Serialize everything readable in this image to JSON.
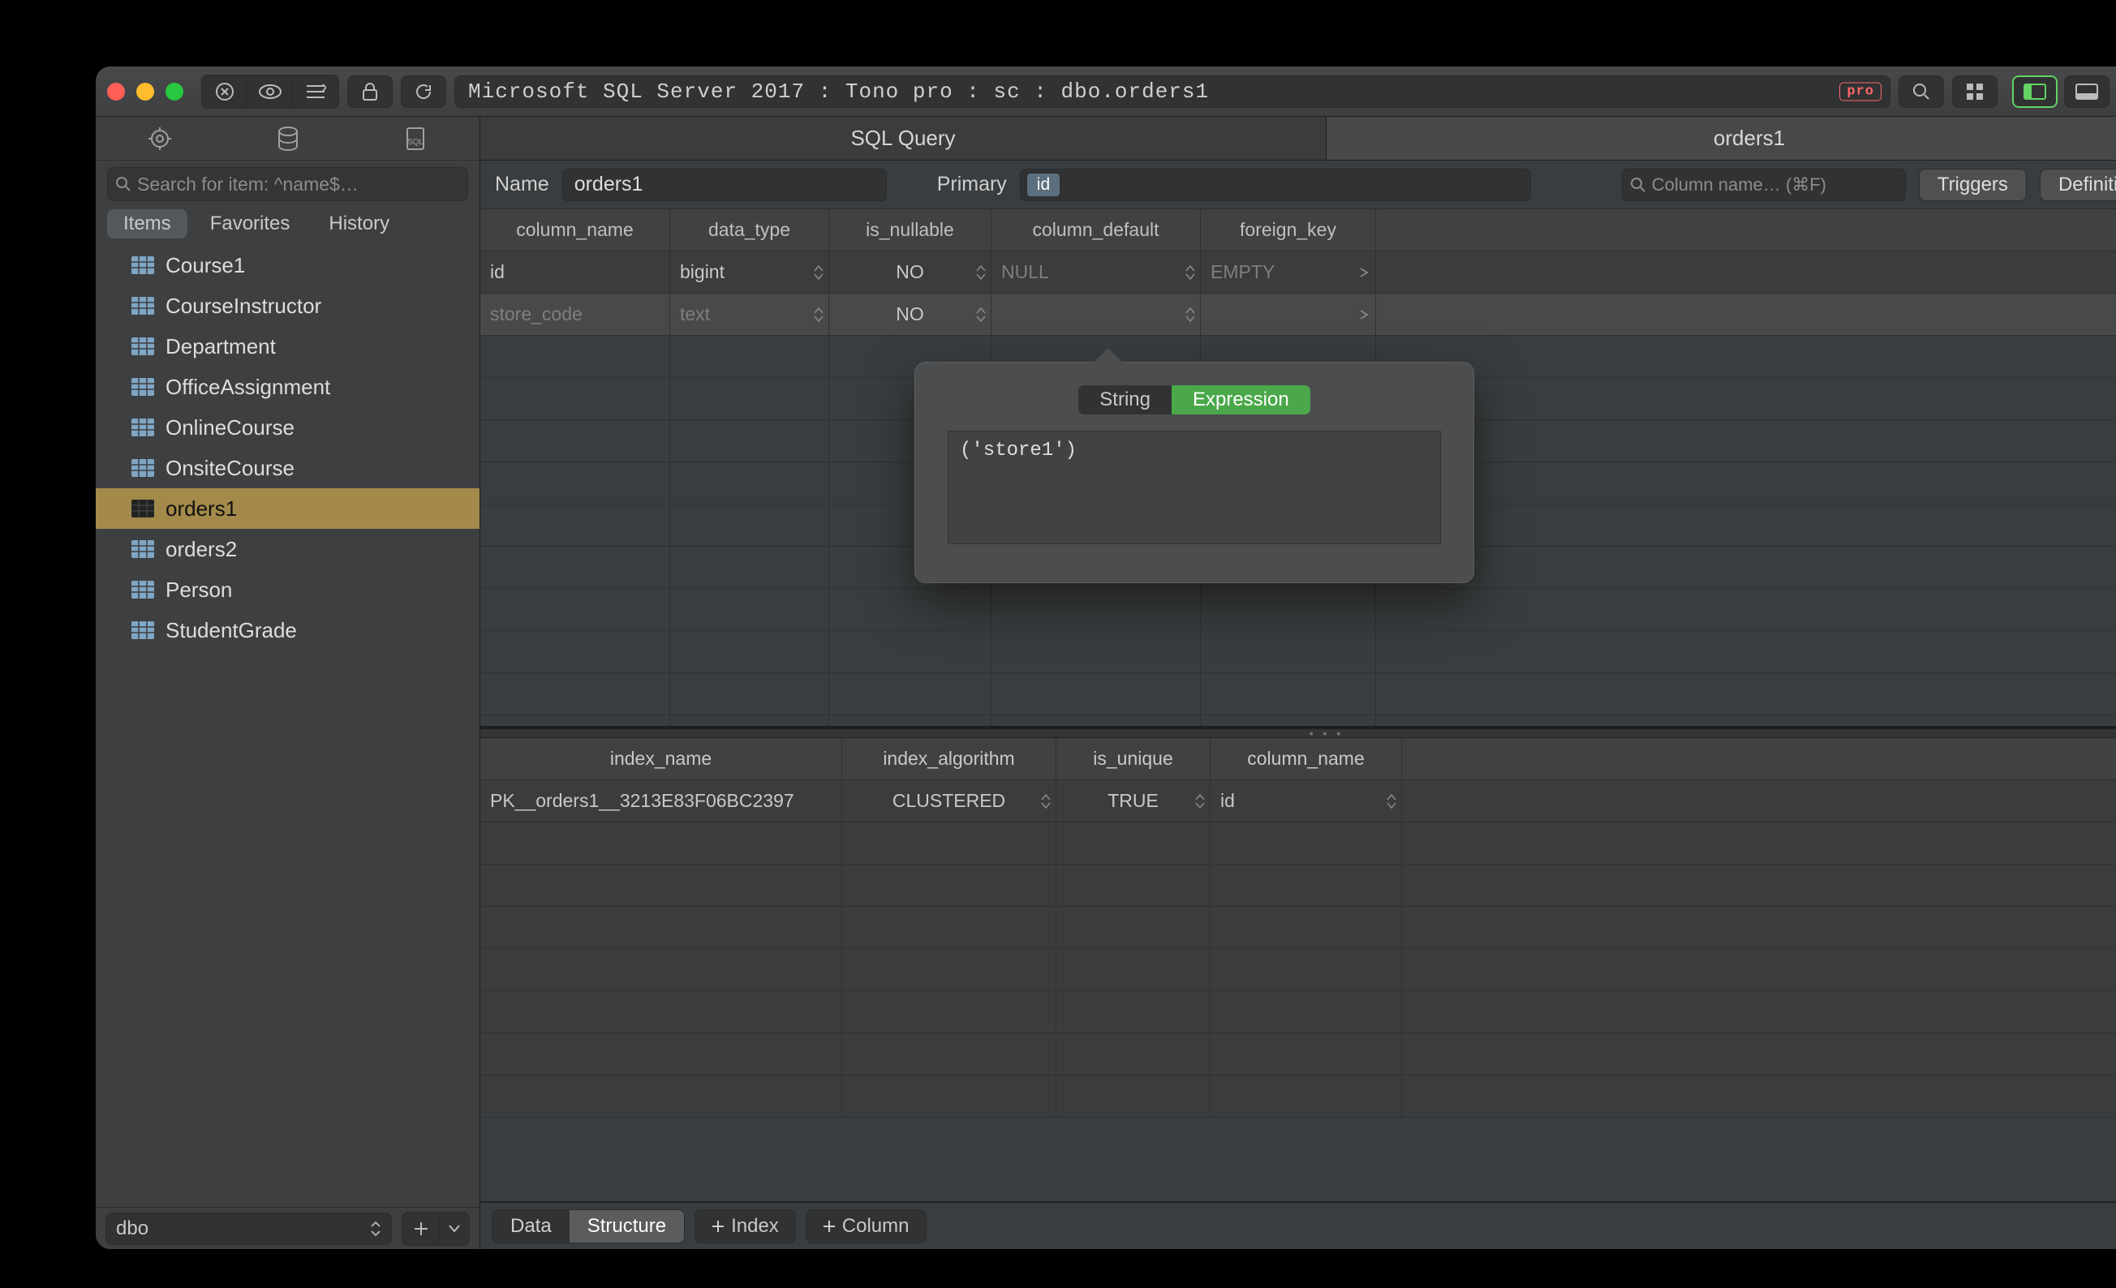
{
  "titlebar": {
    "breadcrumb": "Microsoft SQL Server 2017 : Tono pro : sc : dbo.orders1",
    "pro_badge": "pro"
  },
  "sidebar": {
    "search_placeholder": "Search for item: ^name$…",
    "tabs": {
      "items": "Items",
      "favorites": "Favorites",
      "history": "History"
    },
    "items": [
      "Course1",
      "CourseInstructor",
      "Department",
      "OfficeAssignment",
      "OnlineCourse",
      "OnsiteCourse",
      "orders1",
      "orders2",
      "Person",
      "StudentGrade"
    ],
    "selected_index": 6,
    "schema": "dbo"
  },
  "main_tabs": {
    "sql": "SQL Query",
    "table": "orders1"
  },
  "name_row": {
    "name_label": "Name",
    "name_value": "orders1",
    "primary_label": "Primary",
    "primary_chip": "id",
    "col_search_placeholder": "Column name… (⌘F)",
    "triggers_btn": "Triggers",
    "definition_btn": "Definition"
  },
  "columns": {
    "headers": {
      "column_name": "column_name",
      "data_type": "data_type",
      "is_nullable": "is_nullable",
      "column_default": "column_default",
      "foreign_key": "foreign_key"
    },
    "rows": [
      {
        "column_name": "id",
        "data_type": "bigint",
        "is_nullable": "NO",
        "column_default": "NULL",
        "foreign_key": "EMPTY",
        "selected": false
      },
      {
        "column_name": "store_code",
        "data_type": "text",
        "is_nullable": "NO",
        "column_default": "",
        "foreign_key": "",
        "selected": true
      }
    ]
  },
  "indexes": {
    "headers": {
      "index_name": "index_name",
      "index_algorithm": "index_algorithm",
      "is_unique": "is_unique",
      "column_name": "column_name"
    },
    "rows": [
      {
        "index_name": "PK__orders1__3213E83F06BC2397",
        "index_algorithm": "CLUSTERED",
        "is_unique": "TRUE",
        "column_name": "id"
      }
    ]
  },
  "footer": {
    "data": "Data",
    "structure": "Structure",
    "add_index": "Index",
    "add_column": "Column"
  },
  "popover": {
    "tab_string": "String",
    "tab_expression": "Expression",
    "value": "('store1')"
  }
}
